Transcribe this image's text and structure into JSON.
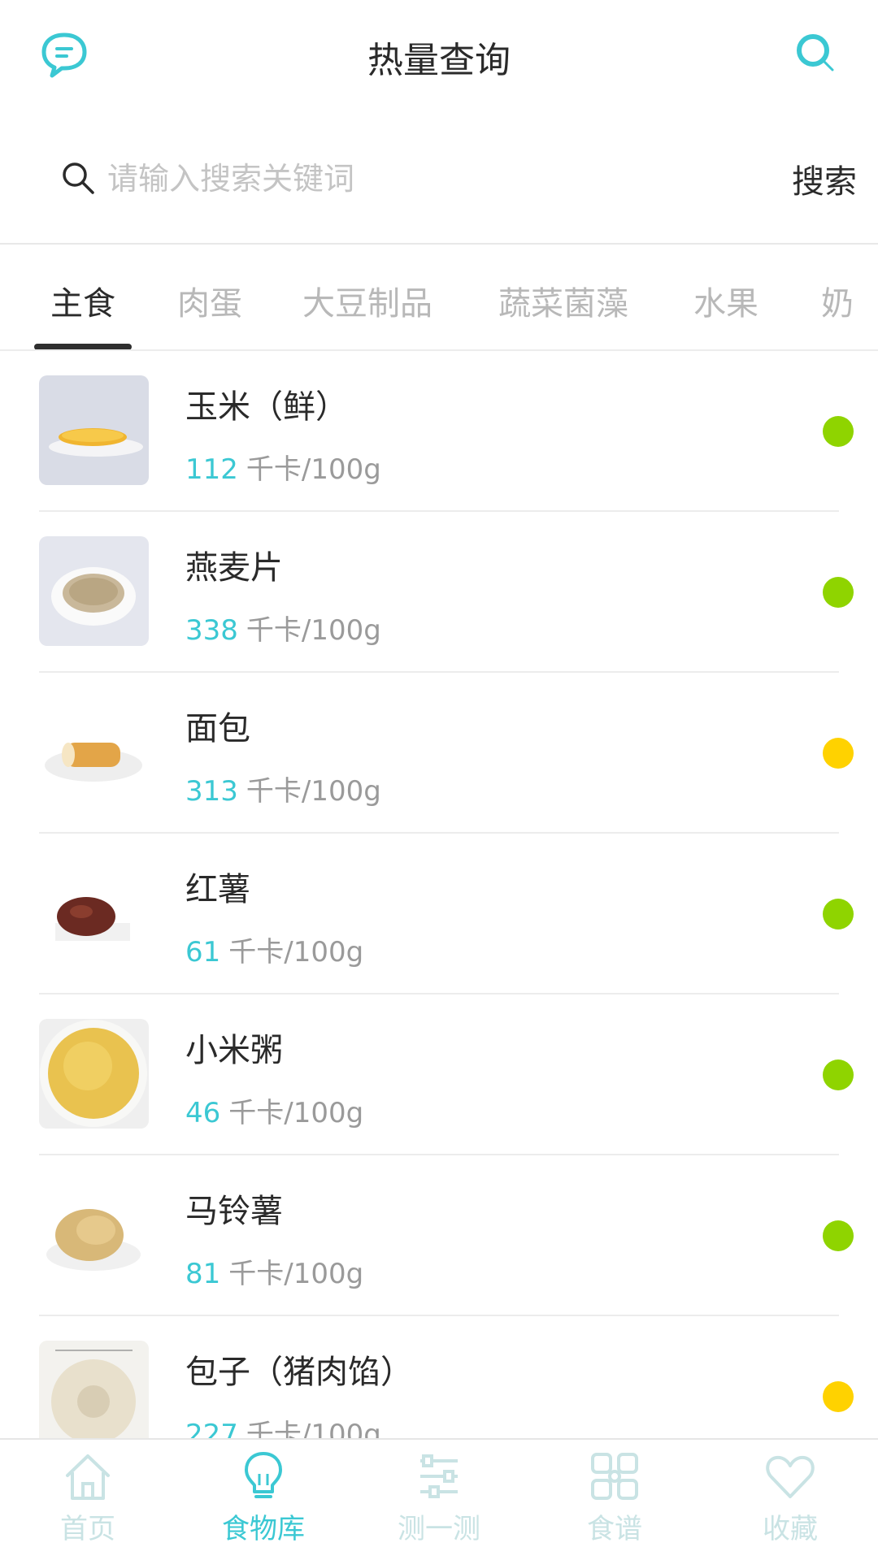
{
  "header": {
    "title": "热量查询",
    "left_icon": "chat-bubble-icon",
    "right_icon": "search-icon"
  },
  "search": {
    "placeholder": "请输入搜索关键词",
    "value": "",
    "button_label": "搜索"
  },
  "tabs": [
    {
      "label": "主食",
      "active": true
    },
    {
      "label": "肉蛋",
      "active": false
    },
    {
      "label": "大豆制品",
      "active": false
    },
    {
      "label": "蔬菜菌藻",
      "active": false
    },
    {
      "label": "水果",
      "active": false
    },
    {
      "label": "奶",
      "active": false
    }
  ],
  "foods": [
    {
      "name": "玉米（鲜）",
      "calories": "112",
      "unit": "千卡/100g",
      "status": "green"
    },
    {
      "name": "燕麦片",
      "calories": "338",
      "unit": "千卡/100g",
      "status": "green"
    },
    {
      "name": "面包",
      "calories": "313",
      "unit": "千卡/100g",
      "status": "yellow"
    },
    {
      "name": "红薯",
      "calories": "61",
      "unit": "千卡/100g",
      "status": "green"
    },
    {
      "name": "小米粥",
      "calories": "46",
      "unit": "千卡/100g",
      "status": "green"
    },
    {
      "name": "马铃薯",
      "calories": "81",
      "unit": "千卡/100g",
      "status": "green"
    },
    {
      "name": "包子（猪肉馅）",
      "calories": "227",
      "unit": "千卡/100g",
      "status": "yellow"
    }
  ],
  "bottom_nav": [
    {
      "label": "首页",
      "icon": "home-icon",
      "active": false
    },
    {
      "label": "食物库",
      "icon": "lightbulb-icon",
      "active": true
    },
    {
      "label": "测一测",
      "icon": "sliders-icon",
      "active": false
    },
    {
      "label": "食谱",
      "icon": "grid-icon",
      "active": false
    },
    {
      "label": "收藏",
      "icon": "heart-icon",
      "active": false
    }
  ],
  "colors": {
    "accent": "#3bc8d3",
    "green": "#8fd400",
    "yellow": "#ffd200"
  }
}
